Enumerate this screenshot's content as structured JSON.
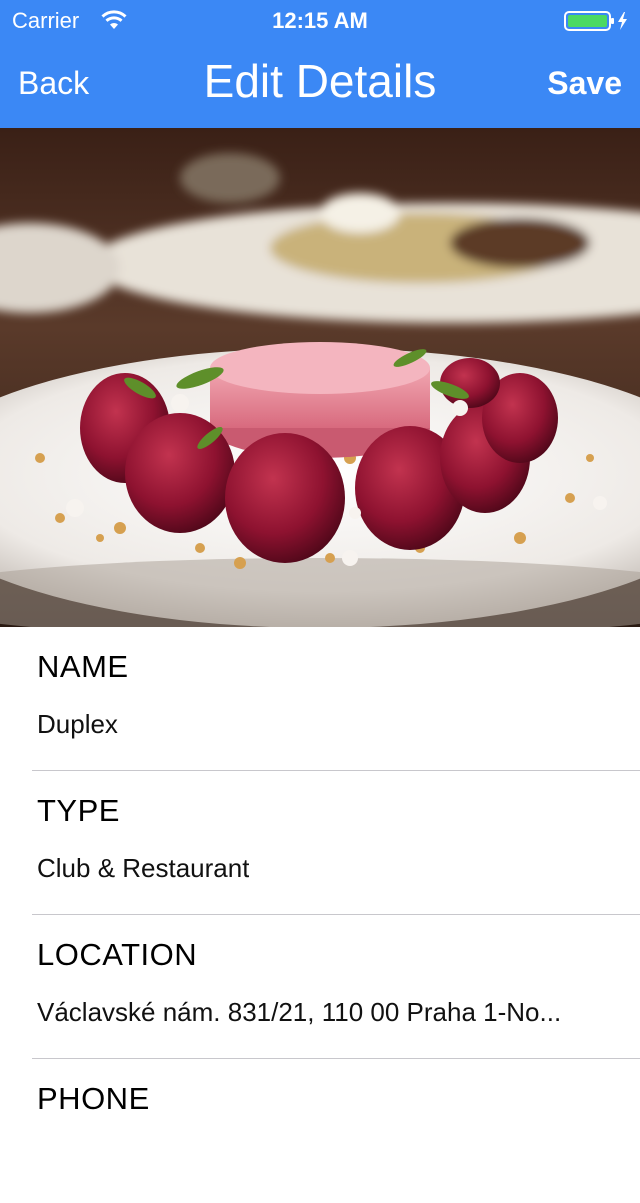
{
  "status_bar": {
    "carrier": "Carrier",
    "time": "12:15 AM",
    "battery_color": "#4cd964"
  },
  "nav": {
    "back_label": "Back",
    "title": "Edit Details",
    "save_label": "Save",
    "background_color": "#3b88f5"
  },
  "fields": [
    {
      "label": "NAME",
      "value": "Duplex"
    },
    {
      "label": "TYPE",
      "value": "Club & Restaurant"
    },
    {
      "label": "LOCATION",
      "value": "Václavské nám. 831/21, 110 00 Praha 1-No..."
    },
    {
      "label": "PHONE",
      "value": ""
    }
  ]
}
